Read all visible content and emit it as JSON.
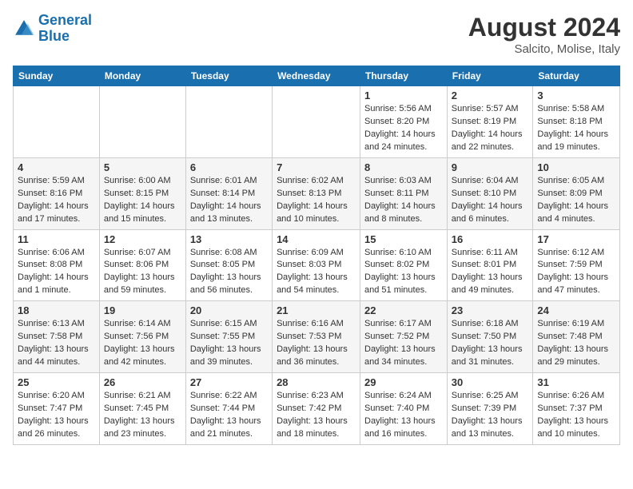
{
  "header": {
    "logo_line1": "General",
    "logo_line2": "Blue",
    "month_year": "August 2024",
    "location": "Salcito, Molise, Italy"
  },
  "days_of_week": [
    "Sunday",
    "Monday",
    "Tuesday",
    "Wednesday",
    "Thursday",
    "Friday",
    "Saturday"
  ],
  "weeks": [
    [
      {
        "day": "",
        "info": ""
      },
      {
        "day": "",
        "info": ""
      },
      {
        "day": "",
        "info": ""
      },
      {
        "day": "",
        "info": ""
      },
      {
        "day": "1",
        "info": "Sunrise: 5:56 AM\nSunset: 8:20 PM\nDaylight: 14 hours and 24 minutes."
      },
      {
        "day": "2",
        "info": "Sunrise: 5:57 AM\nSunset: 8:19 PM\nDaylight: 14 hours and 22 minutes."
      },
      {
        "day": "3",
        "info": "Sunrise: 5:58 AM\nSunset: 8:18 PM\nDaylight: 14 hours and 19 minutes."
      }
    ],
    [
      {
        "day": "4",
        "info": "Sunrise: 5:59 AM\nSunset: 8:16 PM\nDaylight: 14 hours and 17 minutes."
      },
      {
        "day": "5",
        "info": "Sunrise: 6:00 AM\nSunset: 8:15 PM\nDaylight: 14 hours and 15 minutes."
      },
      {
        "day": "6",
        "info": "Sunrise: 6:01 AM\nSunset: 8:14 PM\nDaylight: 14 hours and 13 minutes."
      },
      {
        "day": "7",
        "info": "Sunrise: 6:02 AM\nSunset: 8:13 PM\nDaylight: 14 hours and 10 minutes."
      },
      {
        "day": "8",
        "info": "Sunrise: 6:03 AM\nSunset: 8:11 PM\nDaylight: 14 hours and 8 minutes."
      },
      {
        "day": "9",
        "info": "Sunrise: 6:04 AM\nSunset: 8:10 PM\nDaylight: 14 hours and 6 minutes."
      },
      {
        "day": "10",
        "info": "Sunrise: 6:05 AM\nSunset: 8:09 PM\nDaylight: 14 hours and 4 minutes."
      }
    ],
    [
      {
        "day": "11",
        "info": "Sunrise: 6:06 AM\nSunset: 8:08 PM\nDaylight: 14 hours and 1 minute."
      },
      {
        "day": "12",
        "info": "Sunrise: 6:07 AM\nSunset: 8:06 PM\nDaylight: 13 hours and 59 minutes."
      },
      {
        "day": "13",
        "info": "Sunrise: 6:08 AM\nSunset: 8:05 PM\nDaylight: 13 hours and 56 minutes."
      },
      {
        "day": "14",
        "info": "Sunrise: 6:09 AM\nSunset: 8:03 PM\nDaylight: 13 hours and 54 minutes."
      },
      {
        "day": "15",
        "info": "Sunrise: 6:10 AM\nSunset: 8:02 PM\nDaylight: 13 hours and 51 minutes."
      },
      {
        "day": "16",
        "info": "Sunrise: 6:11 AM\nSunset: 8:01 PM\nDaylight: 13 hours and 49 minutes."
      },
      {
        "day": "17",
        "info": "Sunrise: 6:12 AM\nSunset: 7:59 PM\nDaylight: 13 hours and 47 minutes."
      }
    ],
    [
      {
        "day": "18",
        "info": "Sunrise: 6:13 AM\nSunset: 7:58 PM\nDaylight: 13 hours and 44 minutes."
      },
      {
        "day": "19",
        "info": "Sunrise: 6:14 AM\nSunset: 7:56 PM\nDaylight: 13 hours and 42 minutes."
      },
      {
        "day": "20",
        "info": "Sunrise: 6:15 AM\nSunset: 7:55 PM\nDaylight: 13 hours and 39 minutes."
      },
      {
        "day": "21",
        "info": "Sunrise: 6:16 AM\nSunset: 7:53 PM\nDaylight: 13 hours and 36 minutes."
      },
      {
        "day": "22",
        "info": "Sunrise: 6:17 AM\nSunset: 7:52 PM\nDaylight: 13 hours and 34 minutes."
      },
      {
        "day": "23",
        "info": "Sunrise: 6:18 AM\nSunset: 7:50 PM\nDaylight: 13 hours and 31 minutes."
      },
      {
        "day": "24",
        "info": "Sunrise: 6:19 AM\nSunset: 7:48 PM\nDaylight: 13 hours and 29 minutes."
      }
    ],
    [
      {
        "day": "25",
        "info": "Sunrise: 6:20 AM\nSunset: 7:47 PM\nDaylight: 13 hours and 26 minutes."
      },
      {
        "day": "26",
        "info": "Sunrise: 6:21 AM\nSunset: 7:45 PM\nDaylight: 13 hours and 23 minutes."
      },
      {
        "day": "27",
        "info": "Sunrise: 6:22 AM\nSunset: 7:44 PM\nDaylight: 13 hours and 21 minutes."
      },
      {
        "day": "28",
        "info": "Sunrise: 6:23 AM\nSunset: 7:42 PM\nDaylight: 13 hours and 18 minutes."
      },
      {
        "day": "29",
        "info": "Sunrise: 6:24 AM\nSunset: 7:40 PM\nDaylight: 13 hours and 16 minutes."
      },
      {
        "day": "30",
        "info": "Sunrise: 6:25 AM\nSunset: 7:39 PM\nDaylight: 13 hours and 13 minutes."
      },
      {
        "day": "31",
        "info": "Sunrise: 6:26 AM\nSunset: 7:37 PM\nDaylight: 13 hours and 10 minutes."
      }
    ]
  ]
}
